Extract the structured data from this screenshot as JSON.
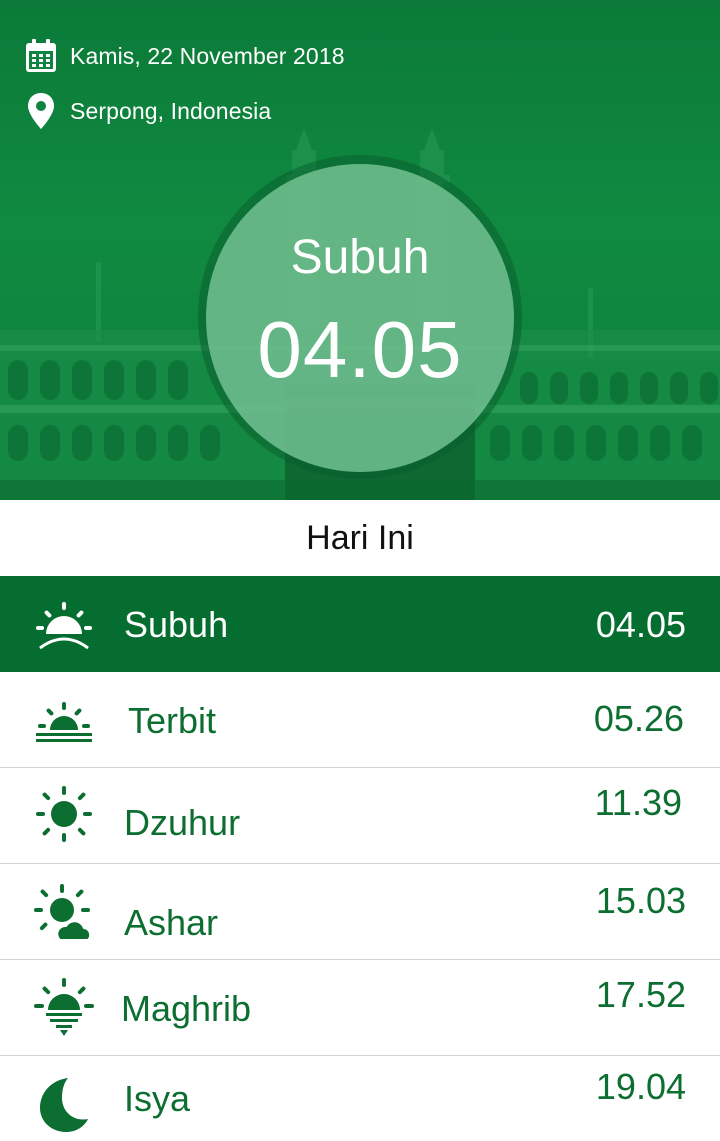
{
  "header": {
    "date": "Kamis, 22 November 2018",
    "location": "Serpong, Indonesia",
    "date_icon": "calendar-icon",
    "location_icon": "map-pin-icon"
  },
  "current": {
    "name": "Subuh",
    "time": "04.05"
  },
  "today_label": "Hari Ini",
  "prayers": [
    {
      "name": "Subuh",
      "time": "04.05",
      "icon": "sunrise-icon",
      "active": true
    },
    {
      "name": "Terbit",
      "time": "05.26",
      "icon": "sun-horizon-icon",
      "active": false
    },
    {
      "name": "Dzuhur",
      "time": "11.39",
      "icon": "sun-icon",
      "active": false
    },
    {
      "name": "Ashar",
      "time": "15.03",
      "icon": "sun-cloud-icon",
      "active": false
    },
    {
      "name": "Maghrib",
      "time": "17.52",
      "icon": "sunset-icon",
      "active": false
    },
    {
      "name": "Isya",
      "time": "19.04",
      "icon": "moon-icon",
      "active": false
    }
  ],
  "colors": {
    "primary": "#046d2f",
    "hero": "#108a41",
    "text_green": "#0d6e31"
  }
}
